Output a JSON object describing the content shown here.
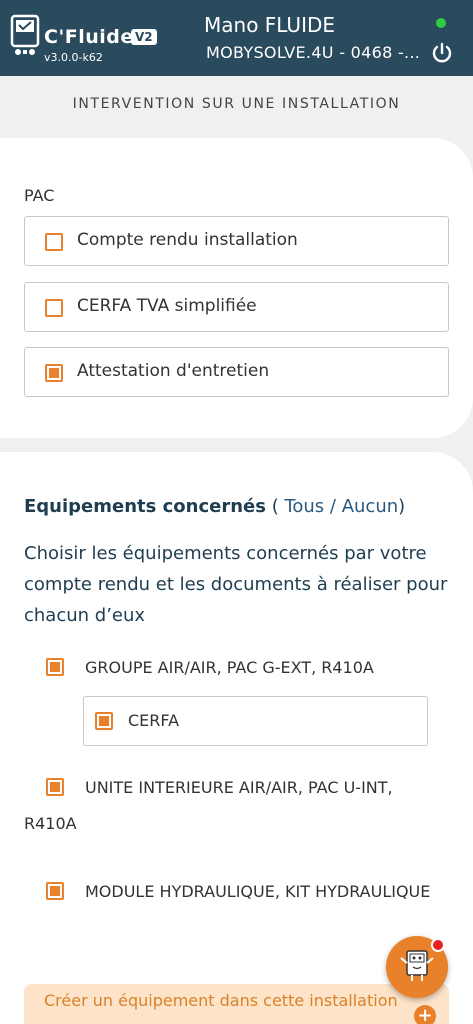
{
  "header": {
    "app_name": "C'Fluide",
    "badge": "V2",
    "version": "v3.0.0-k62",
    "user_name": "Mano FLUIDE",
    "account": "MOBYSOLVE.4U - 0468 -...",
    "status_color": "#2ecc40"
  },
  "page": {
    "subtitle": "INTERVENTION SUR UNE INSTALLATION"
  },
  "documents": {
    "section_label": "PAC",
    "options": [
      {
        "label": "Compte rendu installation",
        "checked": false
      },
      {
        "label": "CERFA TVA simplifiée",
        "checked": false
      },
      {
        "label": "Attestation d'entretien",
        "checked": true
      }
    ]
  },
  "equipments": {
    "title": "Equipements concernés",
    "paren_open": " (",
    "all_link": " Tous",
    "sep": " / ",
    "none_link": "Aucun",
    "paren_close": ")",
    "description": "Choisir les équipements concernés par votre compte rendu et les documents à réaliser pour chacun d’eux",
    "items": [
      {
        "label": "GROUPE AIR/AIR, PAC G-EXT, R410A",
        "checked": true,
        "sub_label": "CERFA",
        "sub_checked": true
      },
      {
        "label": "UNITE INTERIEURE AIR/AIR, PAC U-INT, R410A",
        "checked": true
      },
      {
        "label": "MODULE HYDRAULIQUE, KIT HYDRAULIQUE",
        "checked": true
      }
    ],
    "create_label": "Créer un équipement dans cette installation",
    "plus": "+"
  },
  "colors": {
    "header_bg": "#2a4a5e",
    "accent": "#e8812a",
    "notification": "#e82020"
  }
}
